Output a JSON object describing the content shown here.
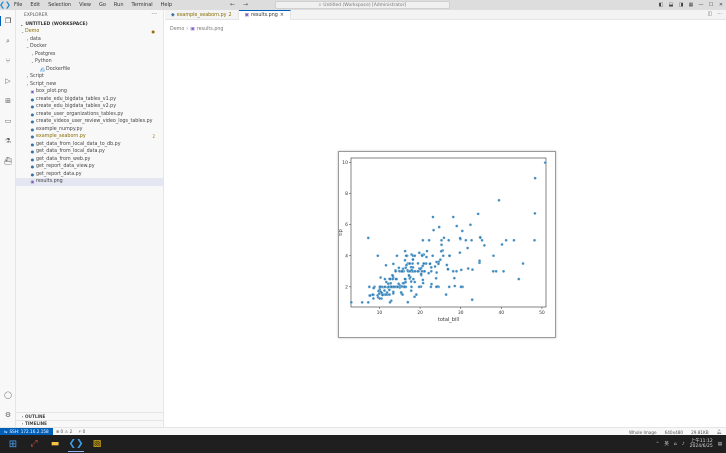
{
  "titlebar": {
    "menu": [
      "File",
      "Edit",
      "Selection",
      "View",
      "Go",
      "Run",
      "Terminal",
      "Help"
    ],
    "command_center": "Untitled (Workspace) [Administrator]"
  },
  "sidebar": {
    "header": "EXPLORER",
    "workspace": "UNTITLED (WORKSPACE)",
    "items": [
      {
        "label": "Demo",
        "depth": 0,
        "type": "folder",
        "open": true,
        "modified": true
      },
      {
        "label": "data",
        "depth": 1,
        "type": "folder",
        "open": false
      },
      {
        "label": "Docker",
        "depth": 1,
        "type": "folder",
        "open": true
      },
      {
        "label": "Postgres",
        "depth": 2,
        "type": "folder",
        "open": false
      },
      {
        "label": "Python",
        "depth": 2,
        "type": "folder",
        "open": true
      },
      {
        "label": "Dockerfile",
        "depth": 3,
        "type": "docker"
      },
      {
        "label": "Script",
        "depth": 1,
        "type": "folder",
        "open": false
      },
      {
        "label": "Script_new",
        "depth": 1,
        "type": "folder",
        "open": false
      },
      {
        "label": "box_plot.png",
        "depth": 1,
        "type": "image"
      },
      {
        "label": "create_edu_bigdata_tables_v1.py",
        "depth": 1,
        "type": "python"
      },
      {
        "label": "create_edu_bigdata_tables_v2.py",
        "depth": 1,
        "type": "python"
      },
      {
        "label": "create_user_organizations_tables.py",
        "depth": 1,
        "type": "python"
      },
      {
        "label": "create_videos_user_review_video_logs_tables.py",
        "depth": 1,
        "type": "python"
      },
      {
        "label": "example_numpy.py",
        "depth": 1,
        "type": "python"
      },
      {
        "label": "example_seaborn.py",
        "depth": 1,
        "type": "python",
        "modified": true,
        "badge": "2"
      },
      {
        "label": "get_data_from_local_data_to_db.py",
        "depth": 1,
        "type": "python"
      },
      {
        "label": "get_data_from_local_data.py",
        "depth": 1,
        "type": "python"
      },
      {
        "label": "get_data_from_web.py",
        "depth": 1,
        "type": "python"
      },
      {
        "label": "get_report_data_view.py",
        "depth": 1,
        "type": "python"
      },
      {
        "label": "get_report_data.py",
        "depth": 1,
        "type": "python"
      },
      {
        "label": "results.png",
        "depth": 1,
        "type": "image",
        "selected": true
      }
    ],
    "outline_label": "OUTLINE",
    "timeline_label": "TIMELINE"
  },
  "tabs": [
    {
      "label": "example_seaborn.py",
      "suffix": "2",
      "active": false
    },
    {
      "label": "results.png",
      "suffix": "×",
      "active": true
    }
  ],
  "breadcrumb": [
    "Demo",
    "›",
    "results.png"
  ],
  "chart_data": {
    "type": "scatter",
    "xlabel": "total_bill",
    "ylabel": "tip",
    "xlim": [
      3,
      51
    ],
    "ylim": [
      0.7,
      10.3
    ],
    "xticks": [
      10,
      20,
      30,
      40,
      50
    ],
    "yticks": [
      2,
      4,
      6,
      8,
      10
    ],
    "grid": false,
    "color": "#1f77b4",
    "points": [
      [
        16.99,
        1.01
      ],
      [
        10.34,
        1.66
      ],
      [
        21.01,
        3.5
      ],
      [
        23.68,
        3.31
      ],
      [
        24.59,
        3.61
      ],
      [
        25.29,
        4.71
      ],
      [
        8.77,
        2.0
      ],
      [
        26.88,
        3.12
      ],
      [
        15.04,
        1.96
      ],
      [
        14.78,
        3.23
      ],
      [
        10.27,
        1.71
      ],
      [
        35.26,
        5.0
      ],
      [
        15.42,
        1.57
      ],
      [
        18.43,
        3.0
      ],
      [
        14.83,
        3.02
      ],
      [
        21.58,
        3.92
      ],
      [
        10.33,
        1.67
      ],
      [
        16.29,
        3.71
      ],
      [
        16.97,
        3.5
      ],
      [
        20.65,
        3.35
      ],
      [
        17.92,
        4.08
      ],
      [
        20.29,
        2.75
      ],
      [
        15.77,
        2.23
      ],
      [
        39.42,
        7.58
      ],
      [
        19.82,
        3.18
      ],
      [
        17.81,
        2.34
      ],
      [
        13.37,
        2.0
      ],
      [
        12.69,
        2.0
      ],
      [
        21.7,
        4.3
      ],
      [
        19.65,
        3.0
      ],
      [
        9.55,
        1.45
      ],
      [
        18.35,
        2.5
      ],
      [
        15.06,
        3.0
      ],
      [
        20.69,
        2.45
      ],
      [
        17.78,
        3.27
      ],
      [
        24.06,
        3.6
      ],
      [
        16.31,
        2.0
      ],
      [
        16.93,
        3.07
      ],
      [
        18.69,
        2.31
      ],
      [
        31.27,
        5.0
      ],
      [
        16.04,
        2.24
      ],
      [
        17.46,
        2.54
      ],
      [
        13.94,
        3.06
      ],
      [
        9.68,
        1.32
      ],
      [
        30.4,
        5.6
      ],
      [
        18.29,
        3.0
      ],
      [
        22.23,
        5.0
      ],
      [
        32.4,
        6.0
      ],
      [
        28.55,
        2.05
      ],
      [
        18.04,
        3.0
      ],
      [
        12.54,
        2.5
      ],
      [
        10.29,
        2.6
      ],
      [
        34.81,
        5.2
      ],
      [
        9.94,
        1.56
      ],
      [
        25.56,
        4.34
      ],
      [
        19.49,
        3.51
      ],
      [
        38.01,
        3.0
      ],
      [
        26.41,
        1.5
      ],
      [
        11.24,
        1.76
      ],
      [
        48.27,
        6.73
      ],
      [
        20.29,
        3.21
      ],
      [
        13.81,
        2.0
      ],
      [
        11.02,
        1.98
      ],
      [
        18.29,
        3.76
      ],
      [
        17.59,
        2.64
      ],
      [
        20.08,
        3.15
      ],
      [
        16.45,
        2.47
      ],
      [
        3.07,
        1.0
      ],
      [
        20.23,
        2.01
      ],
      [
        15.01,
        2.09
      ],
      [
        12.02,
        1.97
      ],
      [
        17.07,
        3.0
      ],
      [
        26.86,
        3.14
      ],
      [
        25.28,
        5.0
      ],
      [
        14.73,
        2.2
      ],
      [
        10.51,
        1.25
      ],
      [
        17.92,
        3.08
      ],
      [
        27.2,
        4.0
      ],
      [
        22.76,
        3.0
      ],
      [
        17.29,
        2.71
      ],
      [
        19.44,
        3.0
      ],
      [
        16.66,
        3.4
      ],
      [
        10.07,
        1.83
      ],
      [
        32.68,
        5.0
      ],
      [
        15.98,
        2.03
      ],
      [
        34.83,
        5.17
      ],
      [
        13.03,
        2.0
      ],
      [
        18.28,
        4.0
      ],
      [
        24.71,
        5.85
      ],
      [
        21.16,
        3.0
      ],
      [
        28.97,
        3.0
      ],
      [
        22.49,
        3.5
      ],
      [
        5.75,
        1.0
      ],
      [
        16.32,
        4.3
      ],
      [
        22.75,
        3.25
      ],
      [
        40.17,
        4.73
      ],
      [
        27.28,
        4.0
      ],
      [
        12.03,
        1.5
      ],
      [
        21.01,
        3.0
      ],
      [
        12.46,
        1.5
      ],
      [
        11.35,
        2.5
      ],
      [
        15.38,
        3.0
      ],
      [
        44.3,
        2.5
      ],
      [
        22.42,
        3.48
      ],
      [
        20.92,
        4.08
      ],
      [
        15.36,
        1.64
      ],
      [
        20.49,
        4.06
      ],
      [
        25.21,
        4.29
      ],
      [
        18.24,
        3.76
      ],
      [
        14.31,
        4.0
      ],
      [
        14.0,
        3.0
      ],
      [
        7.25,
        1.0
      ],
      [
        38.07,
        4.0
      ],
      [
        23.95,
        2.55
      ],
      [
        25.71,
        4.0
      ],
      [
        17.31,
        3.5
      ],
      [
        29.93,
        5.07
      ],
      [
        10.65,
        1.5
      ],
      [
        12.43,
        1.8
      ],
      [
        24.08,
        2.92
      ],
      [
        11.69,
        2.31
      ],
      [
        13.42,
        1.68
      ],
      [
        14.26,
        2.5
      ],
      [
        15.95,
        2.0
      ],
      [
        12.48,
        2.52
      ],
      [
        29.8,
        4.2
      ],
      [
        8.52,
        1.48
      ],
      [
        14.52,
        2.0
      ],
      [
        11.38,
        2.0
      ],
      [
        22.82,
        2.18
      ],
      [
        19.08,
        1.5
      ],
      [
        20.27,
        2.83
      ],
      [
        11.17,
        1.5
      ],
      [
        12.26,
        2.0
      ],
      [
        18.26,
        3.25
      ],
      [
        8.51,
        1.25
      ],
      [
        10.33,
        2.0
      ],
      [
        14.15,
        2.0
      ],
      [
        16.0,
        2.0
      ],
      [
        13.16,
        2.75
      ],
      [
        17.47,
        3.5
      ],
      [
        34.3,
        6.7
      ],
      [
        41.19,
        5.0
      ],
      [
        27.05,
        5.0
      ],
      [
        16.43,
        2.3
      ],
      [
        8.35,
        1.5
      ],
      [
        18.64,
        1.36
      ],
      [
        11.87,
        1.63
      ],
      [
        9.78,
        1.73
      ],
      [
        7.51,
        2.0
      ],
      [
        14.07,
        2.5
      ],
      [
        13.13,
        2.0
      ],
      [
        17.26,
        2.74
      ],
      [
        24.55,
        2.0
      ],
      [
        19.77,
        2.0
      ],
      [
        29.85,
        5.14
      ],
      [
        48.17,
        5.0
      ],
      [
        25.0,
        3.75
      ],
      [
        13.39,
        2.61
      ],
      [
        16.49,
        2.0
      ],
      [
        21.5,
        3.5
      ],
      [
        12.66,
        2.5
      ],
      [
        16.21,
        2.0
      ],
      [
        13.81,
        2.0
      ],
      [
        17.51,
        3.0
      ],
      [
        24.52,
        3.48
      ],
      [
        20.76,
        2.24
      ],
      [
        31.71,
        4.5
      ],
      [
        10.59,
        1.61
      ],
      [
        10.63,
        2.0
      ],
      [
        50.81,
        10.0
      ],
      [
        15.81,
        3.16
      ],
      [
        7.25,
        5.15
      ],
      [
        31.85,
        3.18
      ],
      [
        16.82,
        4.0
      ],
      [
        32.9,
        3.11
      ],
      [
        17.89,
        2.0
      ],
      [
        14.48,
        2.0
      ],
      [
        9.6,
        4.0
      ],
      [
        34.63,
        3.55
      ],
      [
        34.65,
        3.68
      ],
      [
        23.33,
        5.65
      ],
      [
        45.35,
        3.5
      ],
      [
        23.17,
        6.5
      ],
      [
        40.55,
        3.0
      ],
      [
        20.69,
        5.0
      ],
      [
        20.9,
        3.5
      ],
      [
        30.46,
        2.0
      ],
      [
        18.15,
        3.5
      ],
      [
        23.1,
        4.0
      ],
      [
        15.69,
        1.5
      ],
      [
        19.81,
        4.19
      ],
      [
        28.44,
        2.56
      ],
      [
        15.48,
        2.02
      ],
      [
        16.58,
        4.0
      ],
      [
        7.56,
        1.44
      ],
      [
        10.34,
        2.0
      ],
      [
        43.11,
        5.0
      ],
      [
        13.0,
        2.0
      ],
      [
        13.51,
        2.0
      ],
      [
        18.71,
        4.0
      ],
      [
        12.74,
        2.01
      ],
      [
        13.0,
        2.0
      ],
      [
        16.4,
        2.5
      ],
      [
        20.53,
        4.0
      ],
      [
        16.47,
        3.23
      ],
      [
        26.59,
        3.41
      ],
      [
        38.73,
        3.0
      ],
      [
        24.27,
        2.03
      ],
      [
        12.76,
        2.23
      ],
      [
        30.06,
        2.0
      ],
      [
        25.89,
        5.16
      ],
      [
        48.33,
        9.0
      ],
      [
        13.27,
        2.5
      ],
      [
        28.17,
        6.5
      ],
      [
        12.9,
        1.1
      ],
      [
        28.15,
        3.0
      ],
      [
        11.59,
        1.5
      ],
      [
        7.74,
        1.44
      ],
      [
        30.14,
        3.09
      ],
      [
        12.16,
        2.2
      ],
      [
        13.42,
        3.48
      ],
      [
        8.58,
        1.92
      ],
      [
        15.98,
        3.0
      ],
      [
        13.42,
        1.58
      ],
      [
        16.27,
        2.5
      ],
      [
        10.09,
        2.0
      ],
      [
        20.45,
        3.0
      ],
      [
        13.28,
        2.72
      ],
      [
        22.12,
        2.88
      ],
      [
        24.01,
        2.0
      ],
      [
        15.69,
        3.0
      ],
      [
        11.61,
        3.39
      ],
      [
        10.77,
        1.47
      ],
      [
        15.53,
        3.0
      ],
      [
        10.07,
        1.25
      ],
      [
        12.6,
        1.0
      ],
      [
        32.83,
        1.17
      ],
      [
        35.83,
        4.67
      ],
      [
        29.03,
        5.92
      ],
      [
        27.18,
        2.0
      ],
      [
        22.67,
        2.0
      ],
      [
        17.82,
        1.75
      ],
      [
        18.78,
        3.0
      ]
    ]
  },
  "statusbar": {
    "remote": "SSH: 172.16.2.158",
    "problems": "⊗ 0 ⚠ 2",
    "ports": "⚡ 0",
    "layout": "Whole Image",
    "dimensions": "640x480",
    "filesize": "29.81KB"
  },
  "taskbar": {
    "tray_lang": "英",
    "time": "上午11:12",
    "date": "2024/6/25"
  }
}
